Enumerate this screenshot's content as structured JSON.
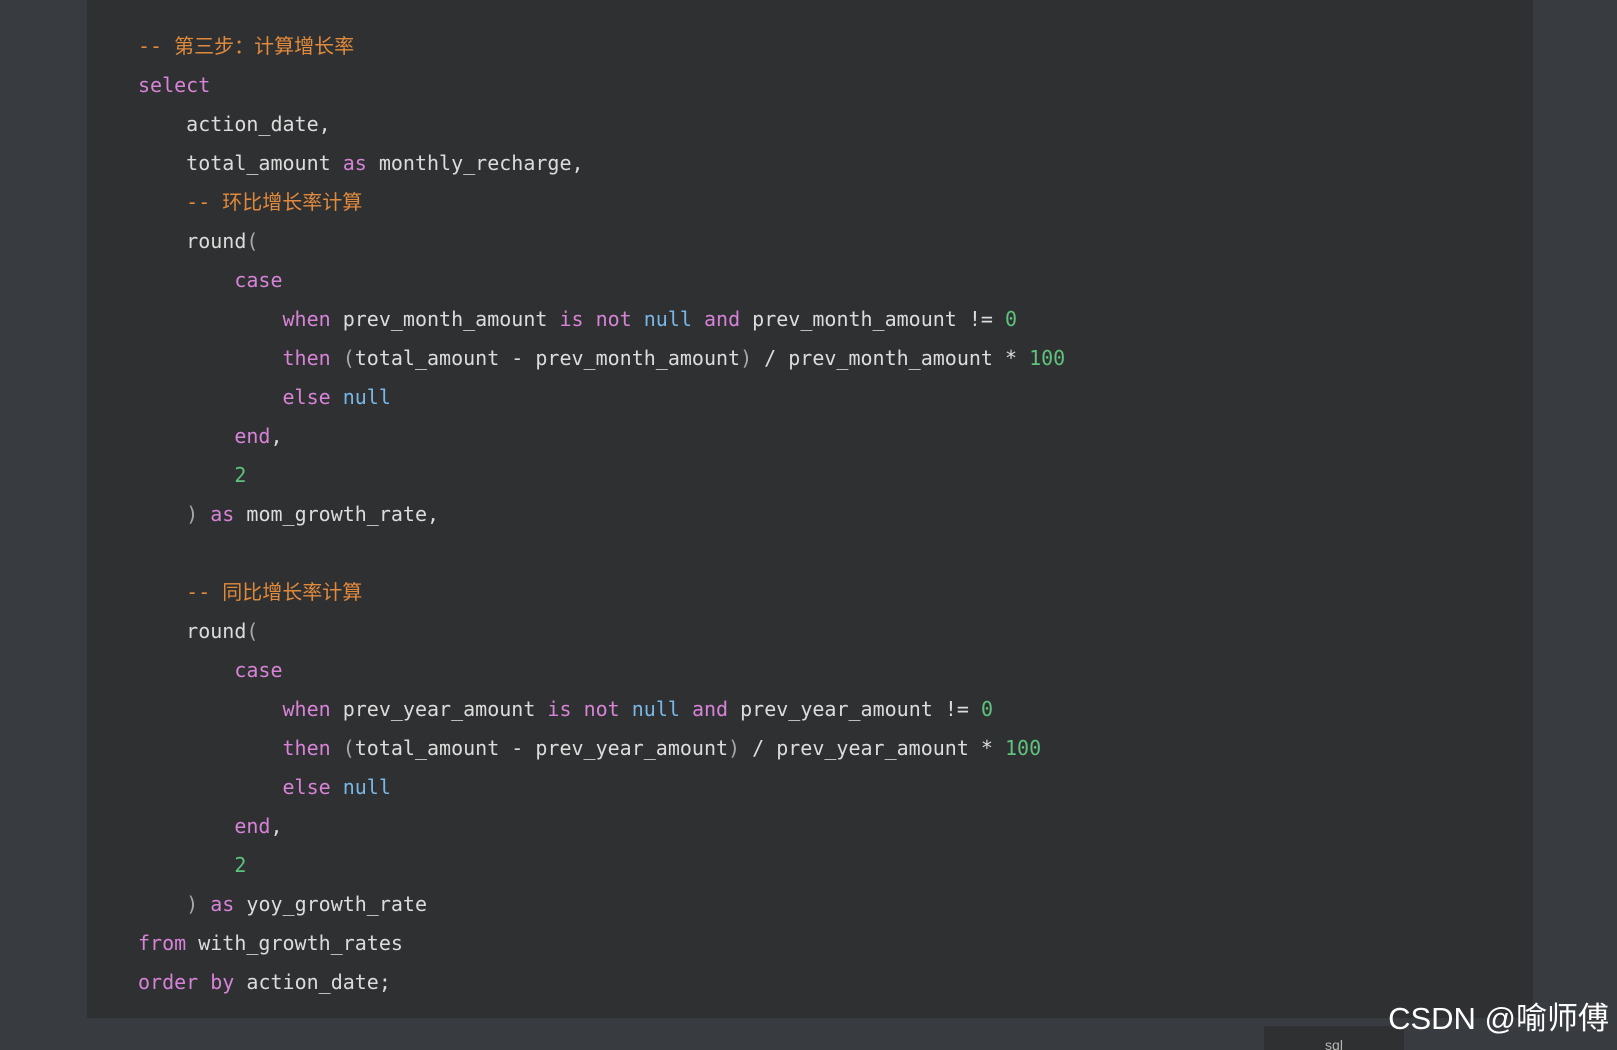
{
  "code_block": {
    "language": "sql",
    "lines": [
      [
        {
          "t": "-- 第三步：计算增长率",
          "c": "comment"
        }
      ],
      [
        {
          "t": "select",
          "c": "kw"
        }
      ],
      [
        {
          "t": "    action_date,",
          "c": "plain"
        }
      ],
      [
        {
          "t": "    total_amount ",
          "c": "plain"
        },
        {
          "t": "as",
          "c": "kw"
        },
        {
          "t": " monthly_recharge,",
          "c": "plain"
        }
      ],
      [
        {
          "t": "    -- 环比增长率计算",
          "c": "comment"
        }
      ],
      [
        {
          "t": "    round",
          "c": "plain"
        },
        {
          "t": "(",
          "c": "paren"
        }
      ],
      [
        {
          "t": "        ",
          "c": "plain"
        },
        {
          "t": "case",
          "c": "kw"
        }
      ],
      [
        {
          "t": "            ",
          "c": "plain"
        },
        {
          "t": "when",
          "c": "kw"
        },
        {
          "t": " prev_month_amount ",
          "c": "plain"
        },
        {
          "t": "is",
          "c": "kw"
        },
        {
          "t": " ",
          "c": "plain"
        },
        {
          "t": "not",
          "c": "kw"
        },
        {
          "t": " ",
          "c": "plain"
        },
        {
          "t": "null",
          "c": "lit"
        },
        {
          "t": " ",
          "c": "plain"
        },
        {
          "t": "and",
          "c": "kw"
        },
        {
          "t": " prev_month_amount != ",
          "c": "plain"
        },
        {
          "t": "0",
          "c": "num"
        }
      ],
      [
        {
          "t": "            ",
          "c": "plain"
        },
        {
          "t": "then",
          "c": "kw"
        },
        {
          "t": " ",
          "c": "plain"
        },
        {
          "t": "(",
          "c": "paren"
        },
        {
          "t": "total_amount - prev_month_amount",
          "c": "plain"
        },
        {
          "t": ")",
          "c": "paren"
        },
        {
          "t": " / prev_month_amount * ",
          "c": "plain"
        },
        {
          "t": "100",
          "c": "num"
        }
      ],
      [
        {
          "t": "            ",
          "c": "plain"
        },
        {
          "t": "else",
          "c": "kw"
        },
        {
          "t": " ",
          "c": "plain"
        },
        {
          "t": "null",
          "c": "lit"
        }
      ],
      [
        {
          "t": "        ",
          "c": "plain"
        },
        {
          "t": "end",
          "c": "kw"
        },
        {
          "t": ",",
          "c": "plain"
        }
      ],
      [
        {
          "t": "        ",
          "c": "plain"
        },
        {
          "t": "2",
          "c": "num"
        }
      ],
      [
        {
          "t": "    ",
          "c": "plain"
        },
        {
          "t": ")",
          "c": "paren"
        },
        {
          "t": " ",
          "c": "plain"
        },
        {
          "t": "as",
          "c": "kw"
        },
        {
          "t": " mom_growth_rate,",
          "c": "plain"
        }
      ],
      [
        {
          "t": "",
          "c": "plain"
        }
      ],
      [
        {
          "t": "    -- 同比增长率计算",
          "c": "comment"
        }
      ],
      [
        {
          "t": "    round",
          "c": "plain"
        },
        {
          "t": "(",
          "c": "paren"
        }
      ],
      [
        {
          "t": "        ",
          "c": "plain"
        },
        {
          "t": "case",
          "c": "kw"
        }
      ],
      [
        {
          "t": "            ",
          "c": "plain"
        },
        {
          "t": "when",
          "c": "kw"
        },
        {
          "t": " prev_year_amount ",
          "c": "plain"
        },
        {
          "t": "is",
          "c": "kw"
        },
        {
          "t": " ",
          "c": "plain"
        },
        {
          "t": "not",
          "c": "kw"
        },
        {
          "t": " ",
          "c": "plain"
        },
        {
          "t": "null",
          "c": "lit"
        },
        {
          "t": " ",
          "c": "plain"
        },
        {
          "t": "and",
          "c": "kw"
        },
        {
          "t": " prev_year_amount != ",
          "c": "plain"
        },
        {
          "t": "0",
          "c": "num"
        }
      ],
      [
        {
          "t": "            ",
          "c": "plain"
        },
        {
          "t": "then",
          "c": "kw"
        },
        {
          "t": " ",
          "c": "plain"
        },
        {
          "t": "(",
          "c": "paren"
        },
        {
          "t": "total_amount - prev_year_amount",
          "c": "plain"
        },
        {
          "t": ")",
          "c": "paren"
        },
        {
          "t": " / prev_year_amount * ",
          "c": "plain"
        },
        {
          "t": "100",
          "c": "num"
        }
      ],
      [
        {
          "t": "            ",
          "c": "plain"
        },
        {
          "t": "else",
          "c": "kw"
        },
        {
          "t": " ",
          "c": "plain"
        },
        {
          "t": "null",
          "c": "lit"
        }
      ],
      [
        {
          "t": "        ",
          "c": "plain"
        },
        {
          "t": "end",
          "c": "kw"
        },
        {
          "t": ",",
          "c": "plain"
        }
      ],
      [
        {
          "t": "        ",
          "c": "plain"
        },
        {
          "t": "2",
          "c": "num"
        }
      ],
      [
        {
          "t": "    ",
          "c": "plain"
        },
        {
          "t": ")",
          "c": "paren"
        },
        {
          "t": " ",
          "c": "plain"
        },
        {
          "t": "as",
          "c": "kw"
        },
        {
          "t": " yoy_growth_rate",
          "c": "plain"
        }
      ],
      [
        {
          "t": "from",
          "c": "kw"
        },
        {
          "t": " with_growth_rates",
          "c": "plain"
        }
      ],
      [
        {
          "t": "order",
          "c": "kw"
        },
        {
          "t": " ",
          "c": "plain"
        },
        {
          "t": "by",
          "c": "kw"
        },
        {
          "t": " action_date;",
          "c": "plain"
        }
      ]
    ]
  },
  "watermark": "CSDN @喻师傅",
  "colors": {
    "page_background": "#383b40",
    "code_background": "#2f3032",
    "keyword": "#d783d7",
    "literal": "#78b7e7",
    "number": "#5fc27d",
    "comment": "#e08a3d",
    "plain": "#dcdcdc"
  }
}
